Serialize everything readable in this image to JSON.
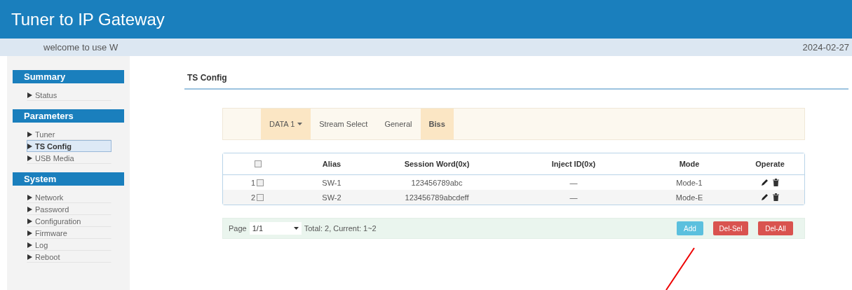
{
  "header": {
    "title": "Tuner to IP Gateway"
  },
  "welcome_bar": {
    "message": "welcome to use W",
    "date": "2024-02-27"
  },
  "sidebar": {
    "sections": [
      {
        "title": "Summary",
        "items": [
          {
            "label": "Status",
            "selected": false
          }
        ]
      },
      {
        "title": "Parameters",
        "items": [
          {
            "label": "Tuner",
            "selected": false
          },
          {
            "label": "TS Config",
            "selected": true
          },
          {
            "label": "USB Media",
            "selected": false
          }
        ]
      },
      {
        "title": "System",
        "items": [
          {
            "label": "Network",
            "selected": false
          },
          {
            "label": "Password",
            "selected": false
          },
          {
            "label": "Configuration",
            "selected": false
          },
          {
            "label": "Firmware",
            "selected": false
          },
          {
            "label": "Log",
            "selected": false
          },
          {
            "label": "Reboot",
            "selected": false
          }
        ]
      }
    ]
  },
  "page": {
    "title": "TS Config"
  },
  "tabs": [
    {
      "label": "DATA 1",
      "kind": "dropdown",
      "selected": true
    },
    {
      "label": "Stream Select",
      "kind": "tab",
      "selected": false
    },
    {
      "label": "General",
      "kind": "tab",
      "selected": false
    },
    {
      "label": "Biss",
      "kind": "tab",
      "selected": true
    }
  ],
  "table": {
    "select_all_checked": false,
    "columns": [
      "Alias",
      "Session Word(0x)",
      "Inject ID(0x)",
      "Mode",
      "Operate"
    ],
    "rows": [
      {
        "index": "1",
        "checked": false,
        "alias": "SW-1",
        "session_word": "123456789abc",
        "inject_id": "—",
        "mode": "Mode-1"
      },
      {
        "index": "2",
        "checked": false,
        "alias": "SW-2",
        "session_word": "123456789abcdeff",
        "inject_id": "—",
        "mode": "Mode-E"
      }
    ]
  },
  "pager": {
    "label": "Page",
    "page": "1/1",
    "summary": "Total: 2, Current: 1~2"
  },
  "buttons": [
    {
      "label": "Add",
      "kind": "info"
    },
    {
      "label": "Del-Sel",
      "kind": "danger"
    },
    {
      "label": "Del-All",
      "kind": "danger"
    }
  ]
}
